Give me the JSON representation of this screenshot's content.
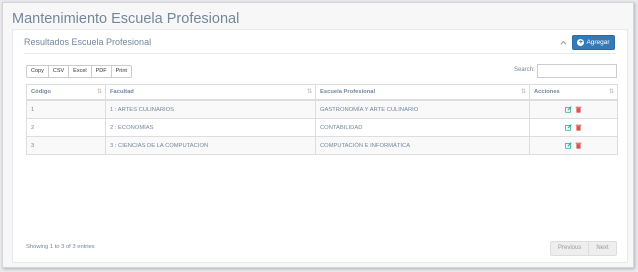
{
  "page": {
    "title": "Mantenimiento Escuela Profesional"
  },
  "panel": {
    "title": "Resultados Escuela Profesional",
    "add_button": "Agregar",
    "collapse_icon": "chevron-up-icon"
  },
  "toolbar": {
    "buttons": [
      "Copy",
      "CSV",
      "Excel",
      "PDF",
      "Print"
    ]
  },
  "search": {
    "label": "Search:",
    "value": ""
  },
  "table": {
    "columns": [
      "Código",
      "Facultad",
      "Escuela Profesional",
      "Acciones"
    ],
    "rows": [
      {
        "codigo": "1",
        "facultad": "1 : ARTES CULINARIOS",
        "escuela": "GASTRONOMÍA Y ARTE CULINARIO"
      },
      {
        "codigo": "2",
        "facultad": "2 : ECONOMÍAS",
        "escuela": "CONTABILIDAD"
      },
      {
        "codigo": "3",
        "facultad": "3 : CIENCIAS DE LA COMPUTACION",
        "escuela": "COMPUTACIÓN E INFORMÁTICA"
      }
    ],
    "action_icons": [
      "edit-icon",
      "delete-icon"
    ]
  },
  "footer": {
    "info": "Showing 1 to 3 of 3 entries",
    "previous": "Previous",
    "next": "Next"
  },
  "colors": {
    "primary": "#337ab7",
    "edit": "#26b99a",
    "delete": "#d9534f",
    "text": "#73879c"
  }
}
